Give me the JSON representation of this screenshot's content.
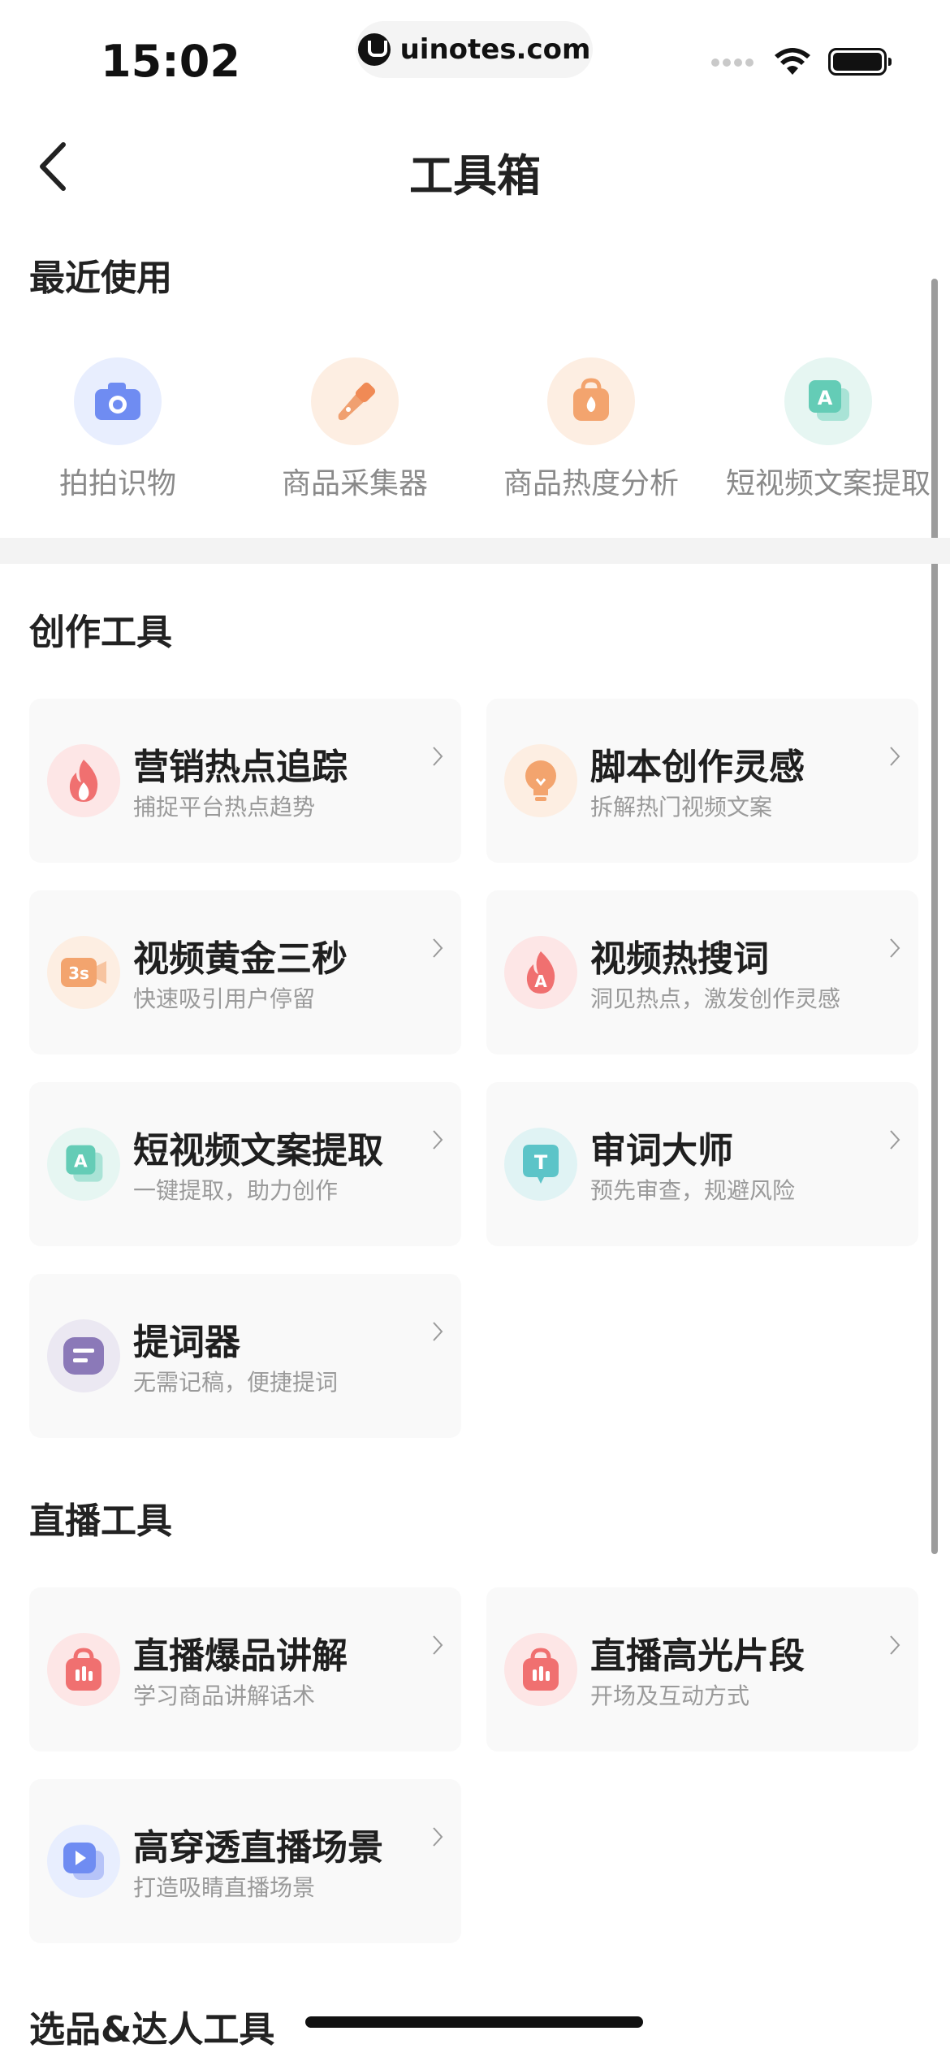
{
  "status_bar": {
    "time": "15:02",
    "url": "uinotes.com"
  },
  "nav": {
    "title": "工具箱"
  },
  "recent": {
    "title": "最近使用",
    "items": [
      {
        "label": "拍拍识物",
        "icon": "camera-icon"
      },
      {
        "label": "商品采集器",
        "icon": "product-collector-icon"
      },
      {
        "label": "商品热度分析",
        "icon": "product-heat-icon"
      },
      {
        "label": "短视频文案提取",
        "icon": "text-extract-icon"
      }
    ]
  },
  "creation": {
    "title": "创作工具",
    "items": [
      {
        "title": "营销热点追踪",
        "subtitle": "捕捉平台热点趋势",
        "icon": "fire-icon"
      },
      {
        "title": "脚本创作灵感",
        "subtitle": "拆解热门视频文案",
        "icon": "lightbulb-icon"
      },
      {
        "title": "视频黄金三秒",
        "subtitle": "快速吸引用户停留",
        "icon": "three-seconds-icon"
      },
      {
        "title": "视频热搜词",
        "subtitle": "洞见热点，激发创作灵感",
        "icon": "hot-search-icon"
      },
      {
        "title": "短视频文案提取",
        "subtitle": "一键提取，助力创作",
        "icon": "text-extract-icon"
      },
      {
        "title": "审词大师",
        "subtitle": "预先审查，规避风险",
        "icon": "text-review-icon"
      },
      {
        "title": "提词器",
        "subtitle": "无需记稿，便捷提词",
        "icon": "teleprompter-icon"
      }
    ]
  },
  "live": {
    "title": "直播工具",
    "items": [
      {
        "title": "直播爆品讲解",
        "subtitle": "学习商品讲解话术",
        "icon": "live-bag-icon"
      },
      {
        "title": "直播高光片段",
        "subtitle": "开场及互动方式",
        "icon": "live-highlight-icon"
      },
      {
        "title": "高穿透直播场景",
        "subtitle": "打造吸睛直播场景",
        "icon": "live-scene-icon"
      }
    ]
  },
  "selection": {
    "title": "选品&达人工具"
  },
  "colors": {
    "background": "#ffffff",
    "card": "#f9f9f9",
    "subtitle": "#9a9a9a"
  }
}
